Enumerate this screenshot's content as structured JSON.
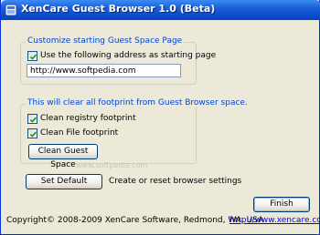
{
  "window": {
    "title": "XenCare Guest Browser 1.0 (Beta)"
  },
  "start_page_group": {
    "legend": "Customize starting Guest Space Page",
    "use_address_checkbox": {
      "label": "Use the following address as starting page",
      "checked": true
    },
    "address_field": {
      "value": "http://www.softpedia.com"
    }
  },
  "footprint_group": {
    "legend": "This will clear all footprint  from Guest Browser space.",
    "clean_registry_checkbox": {
      "label": "Clean registry footprint",
      "checked": true
    },
    "clean_file_checkbox": {
      "label": "Clean File footprint",
      "checked": true
    },
    "clean_button_label": "Clean Guest Space",
    "watermark": "www.softpedia.com"
  },
  "set_default": {
    "button_label": "Set Default",
    "description": "Create or reset browser settings"
  },
  "footer": {
    "finish_label": "Finish",
    "copyright": "Copyright© 2008-2009 XenCare Software, Redmond, WA, USA",
    "website_link": "http://www.xencare.com"
  },
  "colors": {
    "titlebar": "#0a4fd0",
    "group_legend": "#0046d5",
    "window_background": "#ece9d8",
    "link": "#0000ff"
  },
  "icons": {
    "app": "app-icon",
    "check": "check-icon"
  }
}
